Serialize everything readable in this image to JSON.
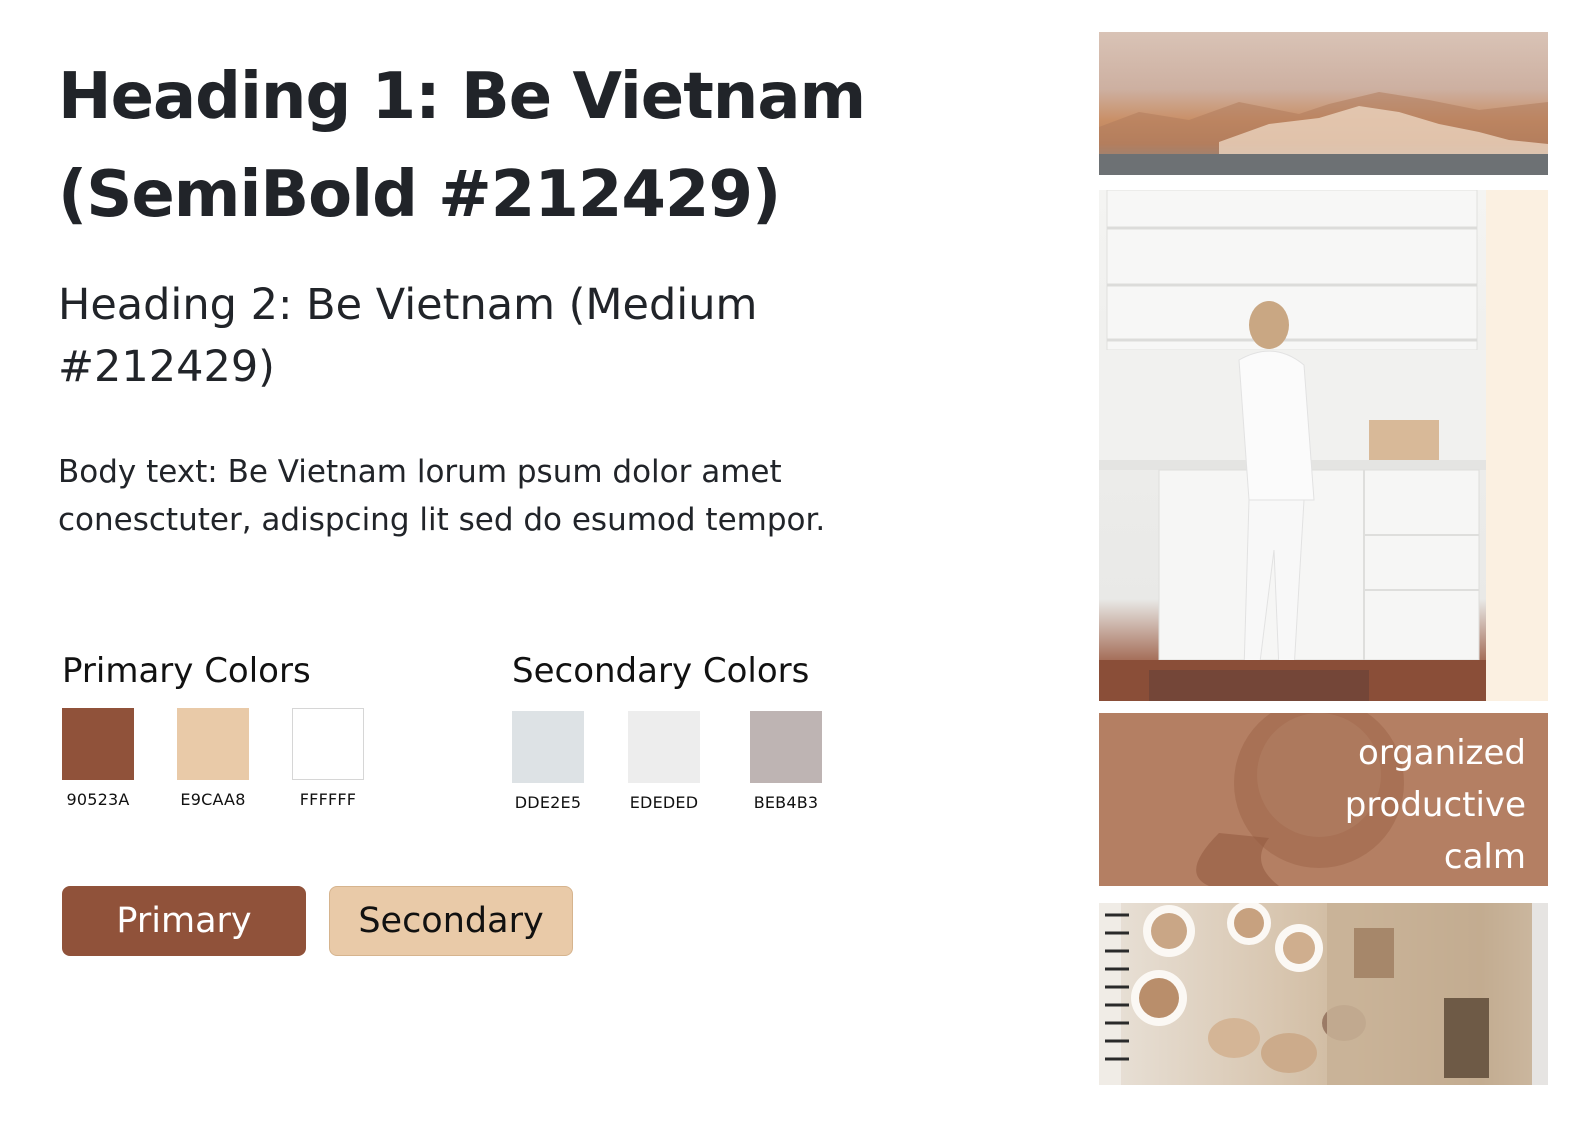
{
  "typography": {
    "heading1": "Heading 1: Be Vietnam (SemiBold #212429)",
    "heading2": "Heading 2: Be Vietnam (Medium #212429)",
    "body": "Body text: Be Vietnam lorum psum dolor amet conesctuter, adispcing lit sed do esumod tempor."
  },
  "primary_colors": {
    "title": "Primary Colors",
    "swatches": [
      {
        "code": "90523A",
        "hex": "#90523A"
      },
      {
        "code": "E9CAA8",
        "hex": "#E9CAA8"
      },
      {
        "code": "FFFFFF",
        "hex": "#FFFFFF"
      }
    ]
  },
  "secondary_colors": {
    "title": "Secondary Colors",
    "swatches": [
      {
        "code": "DDE2E5",
        "hex": "#DDE2E5"
      },
      {
        "code": "EDEDED",
        "hex": "#EDEDED"
      },
      {
        "code": "BEB4B3",
        "hex": "#BEB4B3"
      }
    ]
  },
  "buttons": {
    "primary_label": "Primary",
    "secondary_label": "Secondary"
  },
  "moodboard": {
    "words": [
      "organized",
      "productive",
      "calm"
    ]
  }
}
